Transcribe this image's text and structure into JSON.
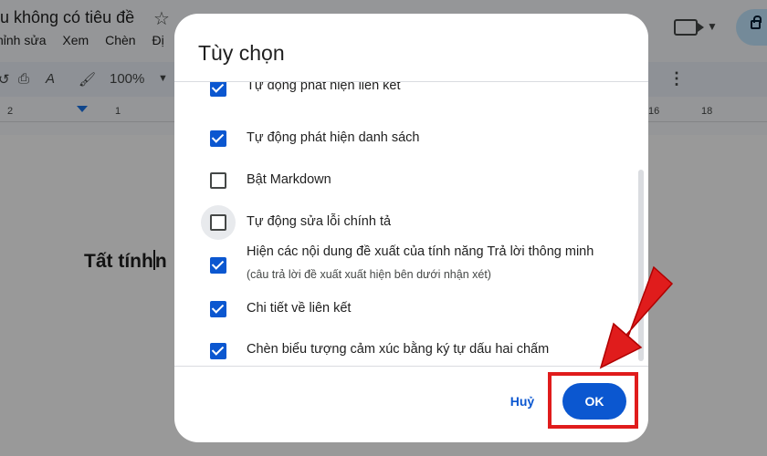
{
  "app": {
    "doc_title": "u không có tiêu đề",
    "menu": [
      "hỉnh sửa",
      "Xem",
      "Chèn",
      "Đị"
    ],
    "zoom": "100%",
    "ruler": [
      "2",
      "1",
      "16",
      "18"
    ],
    "doc_text": "Tất tính",
    "doc_text_tail": "n"
  },
  "dialog": {
    "title": "Tùy chọn",
    "options": [
      {
        "label": "Tự động phát hiện liên kết",
        "checked": true
      },
      {
        "label": "Tự động phát hiện danh sách",
        "checked": true
      },
      {
        "label": "Bật Markdown",
        "checked": false
      },
      {
        "label": "Tự động sửa lỗi chính tả",
        "checked": false
      },
      {
        "label": "Hiện các nội dung đề xuất của tính năng Trả lời thông minh",
        "sub": "(câu trả lời đề xuất xuất hiện bên dưới nhận xét)",
        "checked": true
      },
      {
        "label": "Chi tiết về liên kết",
        "checked": true
      },
      {
        "label": "Chèn biểu tượng cảm xúc bằng ký tự dấu hai chấm",
        "checked": true
      }
    ],
    "cancel_label": "Huỷ",
    "ok_label": "OK"
  },
  "colors": {
    "accent": "#0b57d0",
    "highlight": "#e01c1c"
  }
}
